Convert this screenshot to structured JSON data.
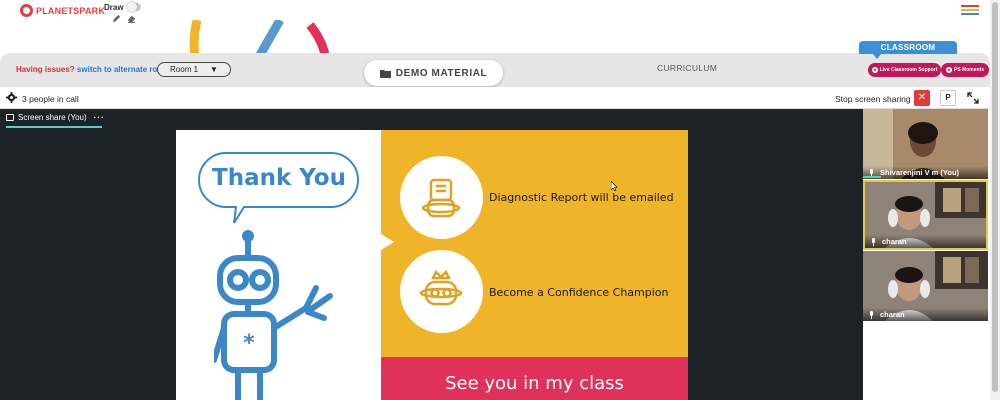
{
  "brand": {
    "logo_text": "PLANETSPARK",
    "color": "#e53e3e"
  },
  "toolbar": {
    "draw_label": "Draw",
    "draw_enabled": false,
    "tools": [
      "pencil-icon",
      "eraser-icon"
    ]
  },
  "menu": {
    "icon": "hamburger-icon",
    "colors": [
      "#e53e3e",
      "#f0b428",
      "#3a88c7"
    ]
  },
  "banner": {
    "issues_text": "Having issues?",
    "switch_link": "switch to alternate room",
    "room_value": "Room 1",
    "demo_material_label": "DEMO MATERIAL",
    "curriculum_label": "CURRICULUM",
    "classroom_tab": "CLASSROOM",
    "live_support_label": "Live Classroom Support",
    "ps_moments_label": "PS Moments"
  },
  "call": {
    "people_text": "3 people in call",
    "stop_share_label": "Stop screen sharing",
    "close_glyph": "✕",
    "p_label": "P"
  },
  "stage": {
    "share_tab_label": "Screen share (You)",
    "more_glyph": "···"
  },
  "slide": {
    "bubble_text": "Thank You",
    "items": [
      {
        "text": "Diagnostic Report will be emailed",
        "icon": "report-robot-icon"
      },
      {
        "text": "Become a Confidence Champion",
        "icon": "crown-robot-icon"
      }
    ],
    "footer_text": "See you in my class",
    "colors": {
      "yellow": "#f0b428",
      "pink": "#e0315a",
      "robot_blue": "#3a88c7"
    }
  },
  "participants": [
    {
      "name": "Shivarenjini V m (You)",
      "active": false
    },
    {
      "name": "charan",
      "active": true
    },
    {
      "name": "charan",
      "active": false
    }
  ]
}
